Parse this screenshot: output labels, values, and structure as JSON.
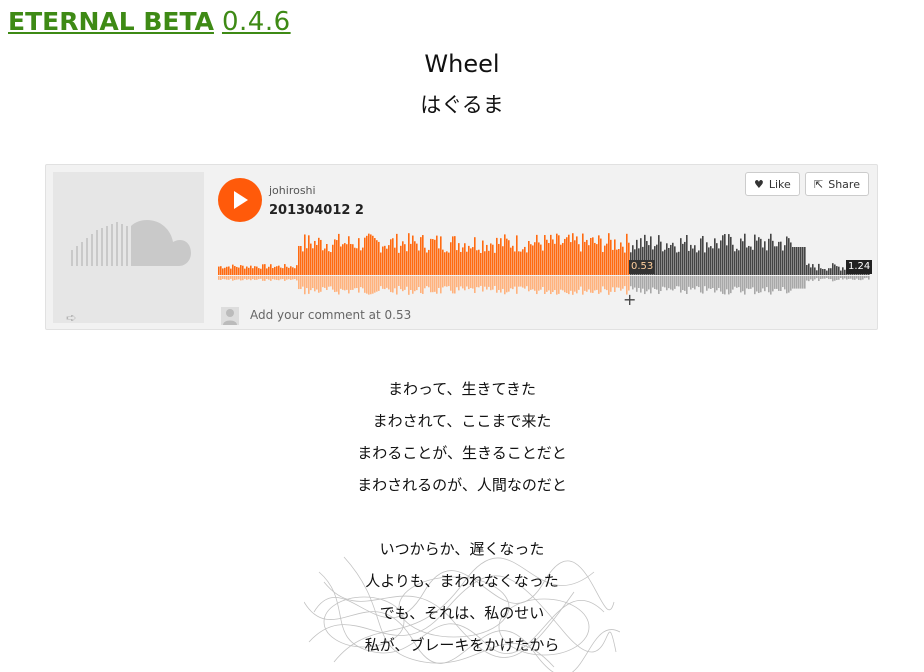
{
  "header": {
    "brand": "ETERNAL BETA",
    "version": "0.4.6"
  },
  "song": {
    "title": "Wheel",
    "subtitle": "はぐるま"
  },
  "player": {
    "uploader": "johiroshi",
    "track_name": "201304012 2",
    "like_label": "Like",
    "share_label": "Share",
    "current_time": "0.53",
    "total_time": "1.24",
    "progress": 0.63,
    "comment_prompt": "Add your comment at 0.53",
    "accent_color": "#ff5a0a",
    "played_color": "#ff6a10",
    "unplayed_color": "#444444"
  },
  "lyrics": {
    "stanza1": [
      "まわって、生きてきた",
      "まわされて、ここまで来た",
      "まわることが、生きることだと",
      "まわされるのが、人間なのだと"
    ],
    "stanza2": [
      "いつからか、遅くなった",
      "人よりも、まわれなくなった",
      "でも、それは、私のせい",
      "私が、ブレーキをかけたから"
    ]
  }
}
